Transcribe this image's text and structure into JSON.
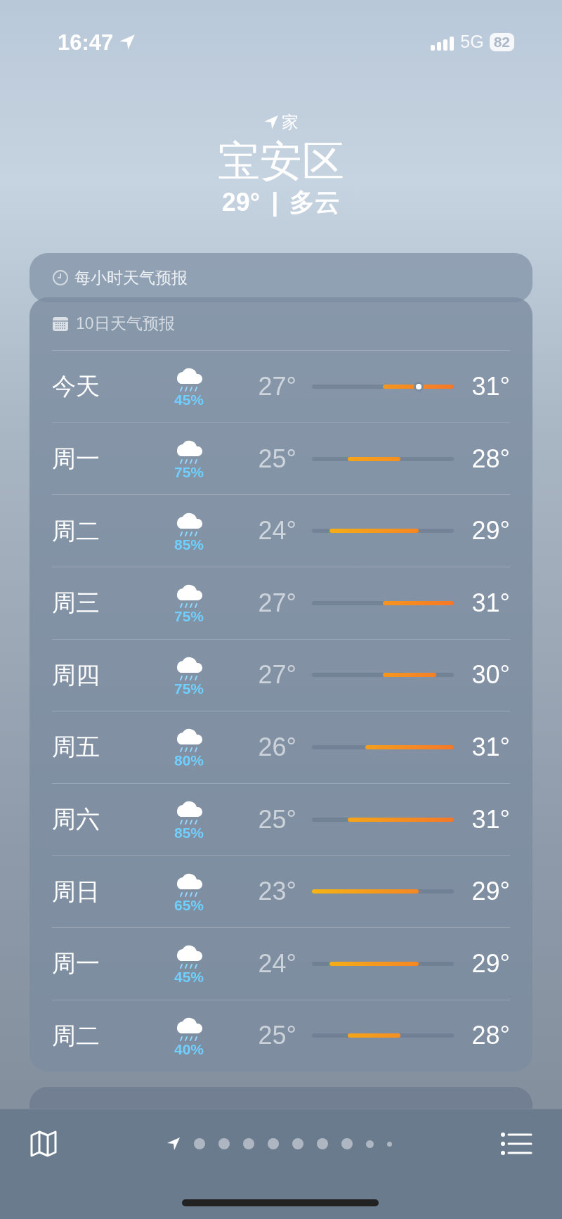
{
  "status_bar": {
    "time": "16:47",
    "network": "5G",
    "battery": "82"
  },
  "location": {
    "label": "家",
    "city": "宝安区",
    "temperature": "29°",
    "separator": "|",
    "condition": "多云"
  },
  "hourly_card": {
    "title": "每小时天气预报"
  },
  "ten_day": {
    "title": "10日天气预报",
    "days": [
      {
        "day": "今天",
        "precip": "45%",
        "low": "27°",
        "high": "31°",
        "now": true
      },
      {
        "day": "周一",
        "precip": "75%",
        "low": "25°",
        "high": "28°",
        "now": false
      },
      {
        "day": "周二",
        "precip": "85%",
        "low": "24°",
        "high": "29°",
        "now": false
      },
      {
        "day": "周三",
        "precip": "75%",
        "low": "27°",
        "high": "31°",
        "now": false
      },
      {
        "day": "周四",
        "precip": "75%",
        "low": "27°",
        "high": "30°",
        "now": false
      },
      {
        "day": "周五",
        "precip": "80%",
        "low": "26°",
        "high": "31°",
        "now": false
      },
      {
        "day": "周六",
        "precip": "85%",
        "low": "25°",
        "high": "31°",
        "now": false
      },
      {
        "day": "周日",
        "precip": "65%",
        "low": "23°",
        "high": "29°",
        "now": false
      },
      {
        "day": "周一",
        "precip": "45%",
        "low": "24°",
        "high": "29°",
        "now": false
      },
      {
        "day": "周二",
        "precip": "40%",
        "low": "25°",
        "high": "28°",
        "now": false
      }
    ]
  },
  "pages": [
    {
      "kind": "location",
      "selected": true
    },
    {
      "kind": "dot",
      "selected": false
    },
    {
      "kind": "dot",
      "selected": false
    },
    {
      "kind": "dot",
      "selected": false
    },
    {
      "kind": "dot",
      "selected": false
    },
    {
      "kind": "dot",
      "selected": false
    },
    {
      "kind": "dot",
      "selected": false
    },
    {
      "kind": "dot",
      "selected": false
    },
    {
      "kind": "small",
      "selected": false
    },
    {
      "kind": "tiny",
      "selected": false
    }
  ]
}
